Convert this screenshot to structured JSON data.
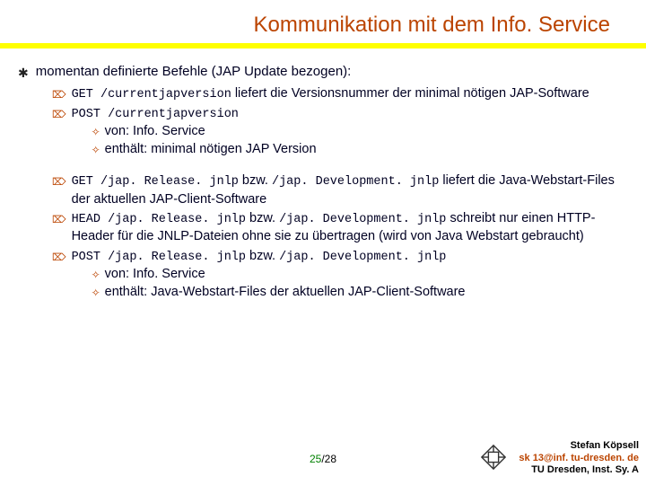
{
  "title": "Kommunikation mit dem Info. Service",
  "heading": "momentan definierte Befehle (JAP Update bezogen):",
  "groupA": {
    "item1": {
      "code": "GET /currentjapversion",
      "text_a": "  liefert die Versionsnummer der minimal nötigen JAP-Software"
    },
    "item2": {
      "code": "POST /currentjapversion",
      "sub1": "von: Info. Service",
      "sub2": "enthält: minimal nötigen JAP Version"
    }
  },
  "groupB": {
    "item1": {
      "code1": "GET /jap. Release. jnlp",
      "mid": " bzw. ",
      "code2": "/jap. Development. jnlp",
      "text_a": "    liefert die Java-Webstart-Files der aktuellen JAP-Client-Software"
    },
    "item2": {
      "code1": "HEAD /jap. Release. jnlp",
      "mid": " bzw. ",
      "code2": "/jap. Development. jnlp",
      "text_a": "   schreibt nur einen HTTP-Header für die JNLP-Dateien ohne sie zu übertragen (wird von Java Webstart gebraucht)"
    },
    "item3": {
      "code1": "POST /jap. Release. jnlp",
      "mid": " bzw. ",
      "code2": "/jap. Development. jnlp",
      "sub1": "von: Info. Service",
      "sub2": "enthält: Java-Webstart-Files der aktuellen JAP-Client-Software"
    }
  },
  "footer": {
    "page_current": "25",
    "page_sep": "/",
    "page_total": "28",
    "author": "Stefan Köpsell",
    "email": "sk 13@inf. tu-dresden. de",
    "org": "TU Dresden, Inst. Sy. A"
  },
  "bullets": {
    "l1": "✱",
    "l2": "⌦",
    "l3": "✧"
  }
}
